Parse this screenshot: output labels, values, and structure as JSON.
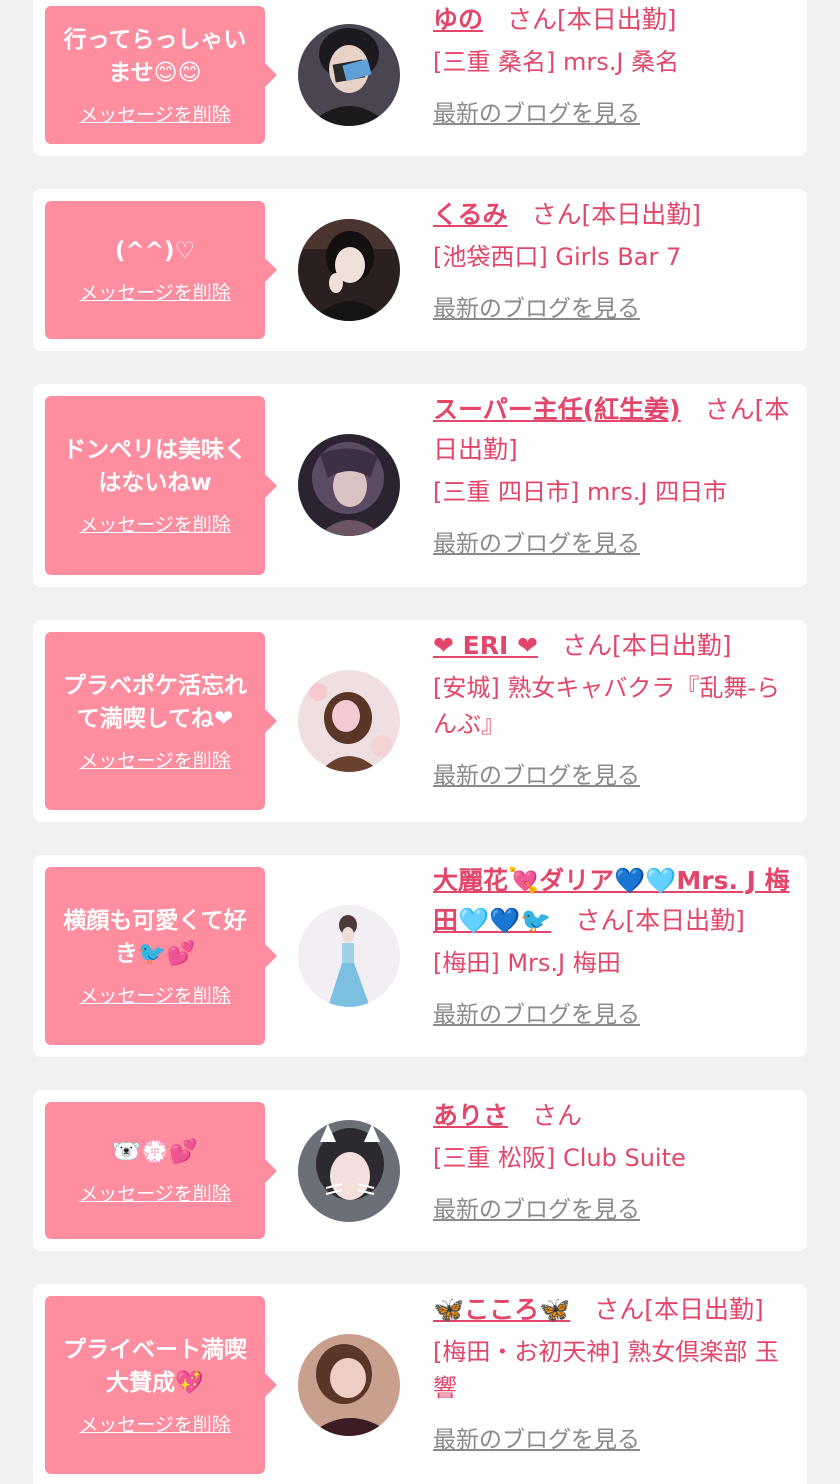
{
  "delete_label": "メッセージを削除",
  "blog_label": "最新のブログを見る",
  "colors": {
    "bubble": "#fd8d9f",
    "accent": "#e2476b",
    "muted": "#8a8a8a",
    "page_bg": "#f1f1f1"
  },
  "items": [
    {
      "message": "行ってらっしゃいませ😊😊",
      "name": "ゆの",
      "suffix": "さん[本日出勤]",
      "shop": "[三重 桑名] mrs.J 桑名",
      "avatar_icon": "girl-photo-icon"
    },
    {
      "message": "(^^)♡",
      "name": "くるみ",
      "suffix": "さん[本日出勤]",
      "shop": "[池袋西口] Girls Bar 7",
      "avatar_icon": "girl-photo-icon"
    },
    {
      "message": "ドンペリは美味くはないねw",
      "name": "スーパー主任(紅生姜)",
      "suffix": "さん[本日出勤]",
      "shop": "[三重 四日市] mrs.J 四日市",
      "avatar_icon": "anime-girl-icon"
    },
    {
      "message": "プラベポケ活忘れて満喫してね❤",
      "name": "❤ ERI ❤",
      "suffix": "さん[本日出勤]",
      "shop": "[安城] 熟女キャバクラ『乱舞-らんぶ』",
      "avatar_icon": "girl-photo-icon"
    },
    {
      "message": "横顔も可愛くて好き🐦💕",
      "name": "大麗花💘ダリア💙🩵Mrs. J 梅田🩵💙🐦",
      "suffix": "さん[本日出勤]",
      "shop": "[梅田] Mrs.J 梅田",
      "avatar_icon": "girl-in-dress-icon"
    },
    {
      "message": "🐻‍❄️💮💕",
      "name": "ありさ",
      "suffix": "さん",
      "shop": "[三重 松阪] Club Suite",
      "avatar_icon": "girl-cat-filter-icon"
    },
    {
      "message": "プライベート満喫大賛成💖",
      "name": "🦋こころ🦋",
      "suffix": "さん[本日出勤]",
      "shop": "[梅田・お初天神] 熟女倶楽部 玉響",
      "avatar_icon": "girl-photo-icon"
    }
  ]
}
